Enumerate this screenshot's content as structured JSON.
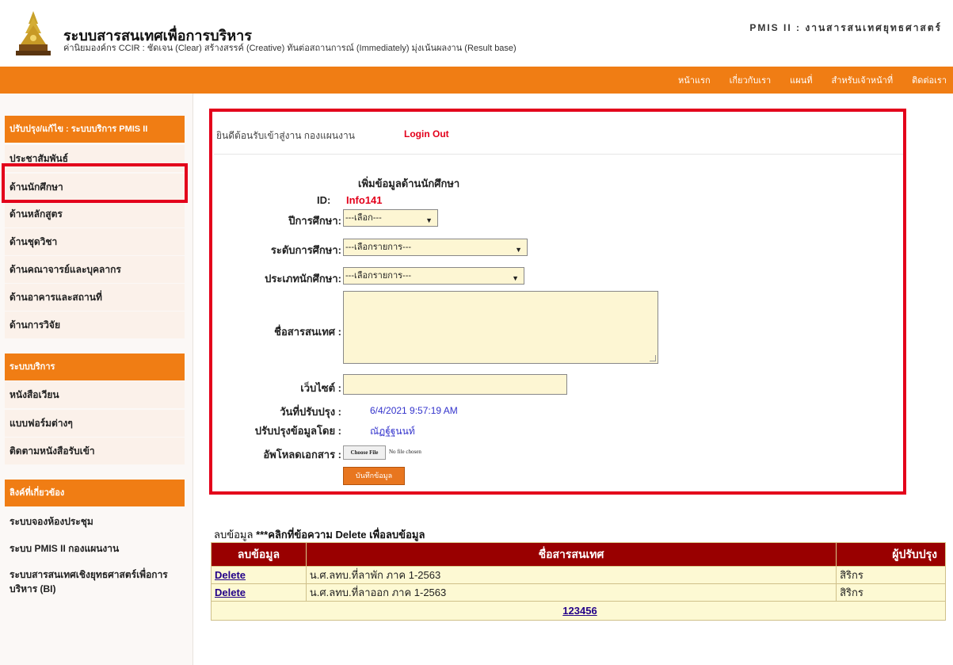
{
  "header": {
    "title": "ระบบสารสนเทศเพื่อการบริหาร",
    "subtitle": "ค่านิยมองค์กร CCIR : ชัดเจน (Clear) สร้างสรรค์ (Creative) ทันต่อสถานการณ์ (Immediately) มุ่งเน้นผลงาน (Result base)",
    "tag": "PMIS II : งานสารสนเทศยุทธศาสตร์"
  },
  "nav": {
    "items": [
      "หน้าแรก",
      "เกี่ยวกับเรา",
      "แผนที่",
      "สำหรับเจ้าหน้าที่",
      "ติดต่อเรา"
    ]
  },
  "sidebar": {
    "section1_title": "ปรับปรุง/แก้ไข : ระบบบริการ PMIS II",
    "section1_items": [
      "ประชาสัมพันธ์",
      "ด้านนักศึกษา",
      "ด้านหลักสูตร",
      "ด้านชุดวิชา",
      "ด้านคณาจารย์และบุคลากร",
      "ด้านอาคารและสถานที่",
      "ด้านการวิจัย"
    ],
    "section2_title": "ระบบบริการ",
    "section2_items": [
      "หนังสือเวียน",
      "แบบฟอร์มต่างๆ",
      "ติดตามหนังสือรับเข้า"
    ],
    "section3_title": "ลิงค์ที่เกี่ยวข้อง",
    "section3_items": [
      "ระบบจองห้องประชุม",
      "ระบบ PMIS II กองแผนงาน",
      "ระบบสารสนเทศเชิงยุทธศาสตร์เพื่อการบริหาร (BI)"
    ]
  },
  "panel": {
    "welcome": "ยินดีต้อนรับเข้าสู่งาน กองแผนงาน",
    "logout": "Login Out"
  },
  "form": {
    "title": "เพิ่มข้อมูลด้านนักศึกษา",
    "id_label": "ID:",
    "id_value": "Info141",
    "year_label": "ปีการศึกษา:",
    "year_value": "---เลือก---",
    "level_label": "ระดับการศึกษา:",
    "level_value": "---เลือกรายการ---",
    "type_label": "ประเภทนักศึกษา:",
    "type_value": "---เลือกรายการ---",
    "name_label": "ชื่อสารสนเทศ :",
    "website_label": "เว็บไซต์ :",
    "updated_label": "วันที่ปรับปรุง :",
    "updated_value": "6/4/2021 9:57:19 AM",
    "updated_by_label": "ปรับปรุงข้อมูลโดย :",
    "updated_by_value": "ณัฏฐ์ฐนนท์",
    "upload_label": "อัพโหลดเอกสาร :",
    "file_button": "Choose File",
    "file_status": "No file chosen",
    "save_button": "บันทึกข้อมูล"
  },
  "table": {
    "caption_prefix": "ลบข้อมูล",
    "caption_text": " ***คลิกที่ข้อความ Delete  เพื่อลบข้อมูล",
    "headers": [
      "ลบข้อมูล",
      "ชื่อสารสนเทศ",
      "ผู้ปรับปรุง"
    ],
    "rows": [
      {
        "action": "Delete",
        "name": "น.ศ.ลทบ.ที่ลาพัก ภาค 1-2563",
        "updater": "สิริกร"
      },
      {
        "action": "Delete",
        "name": "น.ศ.ลทบ.ที่ลาออก ภาค 1-2563",
        "updater": "สิริกร"
      }
    ],
    "pages": [
      "1",
      "2",
      "3",
      "4",
      "5",
      "6"
    ]
  },
  "colors": {
    "accent": "#f07d14",
    "highlight": "#e3001b",
    "table_header": "#990000",
    "field_bg": "#fdf6d3"
  }
}
